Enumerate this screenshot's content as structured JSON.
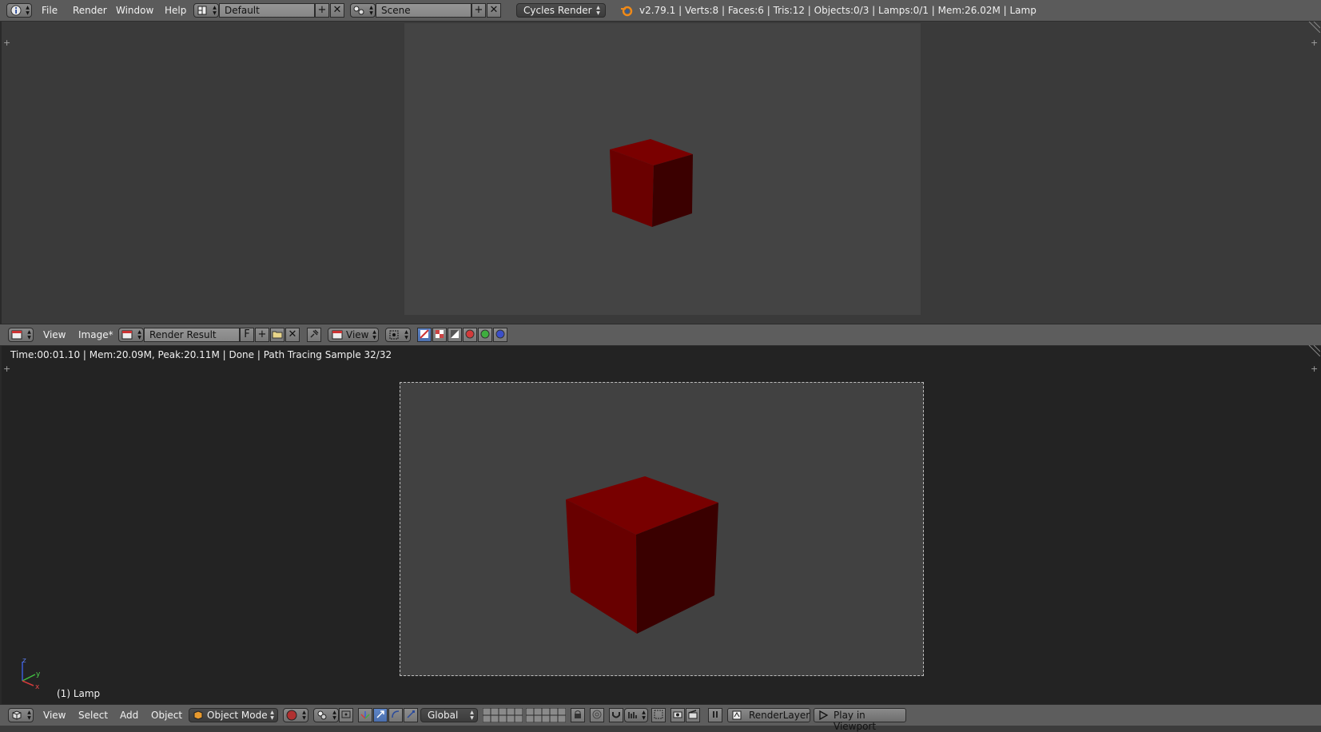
{
  "topbar": {
    "menus": [
      "File",
      "Render",
      "Window",
      "Help"
    ],
    "layout_name": "Default",
    "scene_name": "Scene",
    "render_engine": "Cycles Render",
    "stats": "v2.79.1 | Verts:8 | Faces:6 | Tris:12 | Objects:0/3 | Lamps:0/1 | Mem:26.02M | Lamp"
  },
  "image_editor": {
    "menus": [
      "View",
      "Image*"
    ],
    "image_name": "Render Result",
    "fake_user": "F",
    "view_label": "View"
  },
  "viewport": {
    "render_status": "Time:00:01.10 | Mem:20.09M, Peak:20.11M | Done | Path Tracing Sample 32/32",
    "active_object_label": "(1) Lamp",
    "axis_labels": {
      "x": "x",
      "y": "y",
      "z": "z"
    }
  },
  "view3d_header": {
    "menus": [
      "View",
      "Select",
      "Add",
      "Object"
    ],
    "mode": "Object Mode",
    "orientation": "Global",
    "render_layer": "RenderLayer",
    "play_button": "Play in Viewport"
  },
  "icons": {
    "info": "info-icon",
    "blender": "blender-logo-icon",
    "add": "plus-icon",
    "close": "close-icon"
  },
  "colors": {
    "cube_front": "#6d0000",
    "cube_side": "#3d0000",
    "cube_top": "#7a0000",
    "header": "#5d5d5d",
    "viewport_bg": "#232323"
  }
}
